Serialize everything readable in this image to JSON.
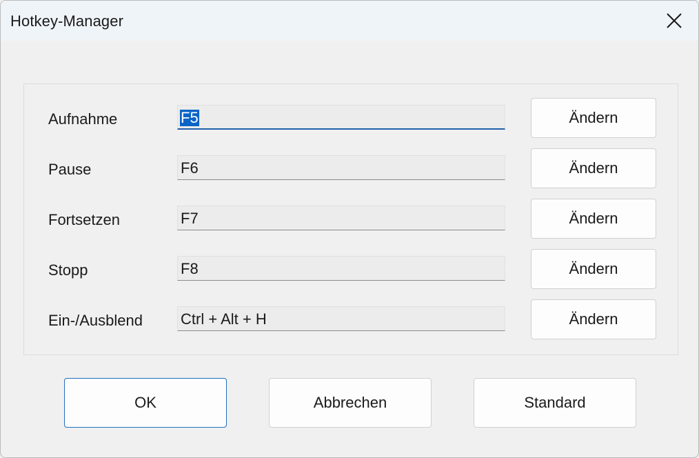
{
  "window": {
    "title": "Hotkey-Manager"
  },
  "hotkeys": [
    {
      "label": "Aufnahme",
      "value": "F5",
      "button": "Ändern"
    },
    {
      "label": "Pause",
      "value": "F6",
      "button": "Ändern"
    },
    {
      "label": "Fortsetzen",
      "value": "F7",
      "button": "Ändern"
    },
    {
      "label": "Stopp",
      "value": "F8",
      "button": "Ändern"
    },
    {
      "label": "Ein-/Ausblend",
      "value": "Ctrl + Alt + H",
      "button": "Ändern"
    }
  ],
  "footer": {
    "ok_label": "OK",
    "cancel_label": "Abbrechen",
    "default_label": "Standard"
  },
  "colors": {
    "accent": "#1f6fc0",
    "selection": "#0a64c8",
    "titlebar": "#eff4f9",
    "dialog_bg": "#f0f0f0"
  },
  "icons": {
    "close": "close-icon"
  }
}
